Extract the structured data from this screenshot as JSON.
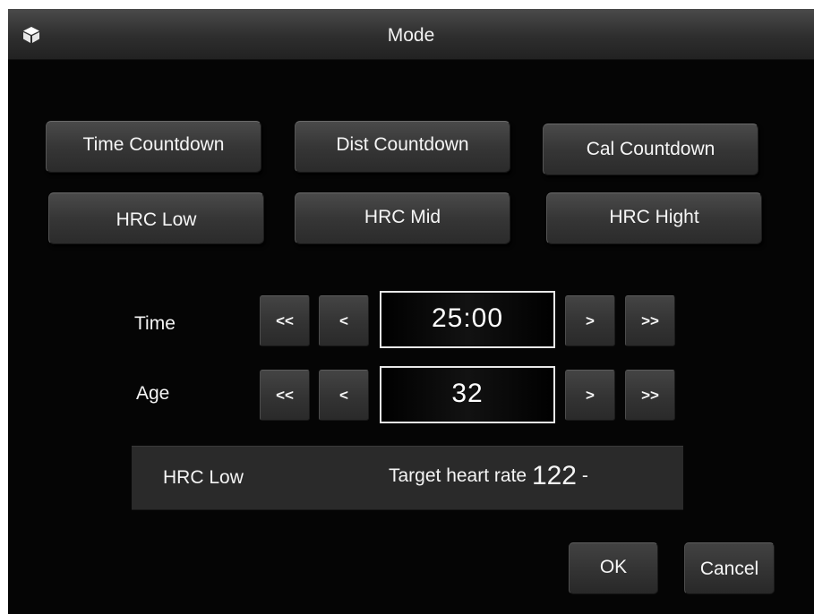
{
  "window": {
    "title": "Mode",
    "icon": "cube-icon"
  },
  "modes": [
    {
      "label": "Time Countdown"
    },
    {
      "label": "Dist Countdown"
    },
    {
      "label": "Cal Countdown"
    },
    {
      "label": "HRC Low"
    },
    {
      "label": "HRC Mid"
    },
    {
      "label": "HRC Hight"
    }
  ],
  "time_row": {
    "label": "Time",
    "dec_fast": "<<",
    "dec": "<",
    "value": "25:00",
    "inc": ">",
    "inc_fast": ">>"
  },
  "age_row": {
    "label": "Age",
    "dec_fast": "<<",
    "dec": "<",
    "value": "32",
    "inc": ">",
    "inc_fast": ">>"
  },
  "info": {
    "mode": "HRC Low",
    "target_label": "Target heart rate",
    "target_value": "122",
    "target_suffix": "-"
  },
  "actions": {
    "ok": "OK",
    "cancel": "Cancel"
  },
  "colors": {
    "background": "#050505",
    "panel": "#2a2a2a",
    "button": "#363636",
    "text": "#f5f5f5",
    "value_border": "#e8e8e8"
  }
}
